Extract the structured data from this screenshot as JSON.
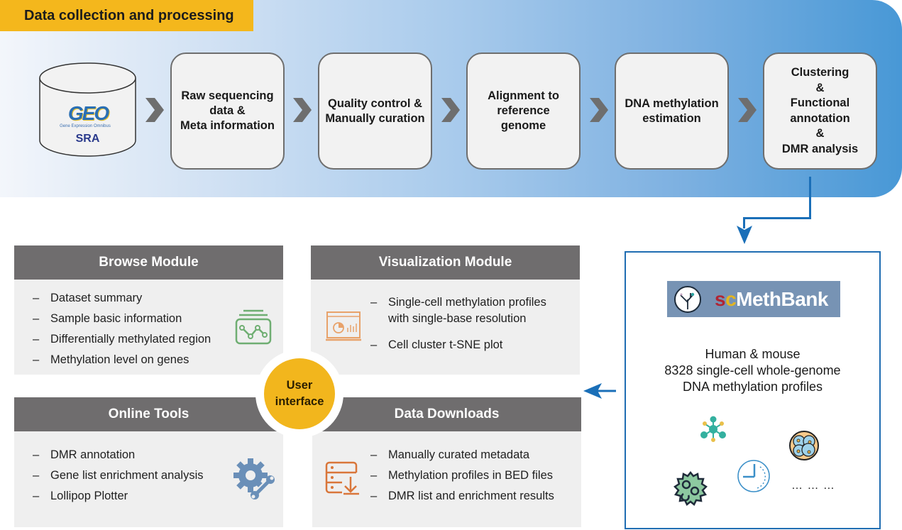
{
  "pipeline": {
    "title": "Data collection and processing",
    "source": {
      "logo_text": "GEO",
      "logo_subtitle": "Gene Expression Omnibus",
      "label": "SRA"
    },
    "steps": [
      {
        "label": "Raw sequencing\ndata &\nMeta information"
      },
      {
        "label": "Quality control &\nManually curation"
      },
      {
        "label": "Alignment to\nreference\ngenome"
      },
      {
        "label": "DNA methylation\nestimation"
      },
      {
        "label": "Clustering\n&\nFunctional\nannotation\n&\nDMR analysis"
      }
    ]
  },
  "user_interface": {
    "label": "User\ninterface"
  },
  "modules": {
    "browse": {
      "title": "Browse Module",
      "icon": "line-chart-panel-icon",
      "items": [
        "Dataset summary",
        "Sample basic information",
        "Differentially methylated region",
        "Methylation level on genes"
      ]
    },
    "visualization": {
      "title": "Visualization Module",
      "icon": "dashboard-chart-icon",
      "items": [
        "Single-cell methylation profiles\nwith single-base resolution",
        "Cell cluster t-SNE plot"
      ]
    },
    "tools": {
      "title": "Online Tools",
      "icon": "gear-wrench-icon",
      "items": [
        "DMR annotation",
        "Gene list enrichment analysis",
        "Lollipop Plotter"
      ]
    },
    "downloads": {
      "title": "Data Downloads",
      "icon": "server-download-icon",
      "items": [
        "Manually curated metadata",
        "Methylation profiles in BED files",
        "DMR list and enrichment results"
      ]
    }
  },
  "database": {
    "logo": {
      "s": "s",
      "c": "c",
      "rest": "MethBank"
    },
    "description": "Human & mouse\n8328 single-cell whole-genome\nDNA methylation profiles",
    "icons": [
      "molecule-network-icon",
      "cell-cluster-icon",
      "clock-icon",
      "virus-cell-icon"
    ],
    "more": "… … …"
  },
  "colors": {
    "accent_yellow": "#f4b71c",
    "arrow_blue": "#1a6fb8",
    "module_header": "#6f6d6e",
    "module_body": "#efefef",
    "browse_icon": "#6fae72",
    "vis_icon": "#e8a26a",
    "tools_icon": "#6a8fb8",
    "downloads_icon": "#d9763a"
  }
}
